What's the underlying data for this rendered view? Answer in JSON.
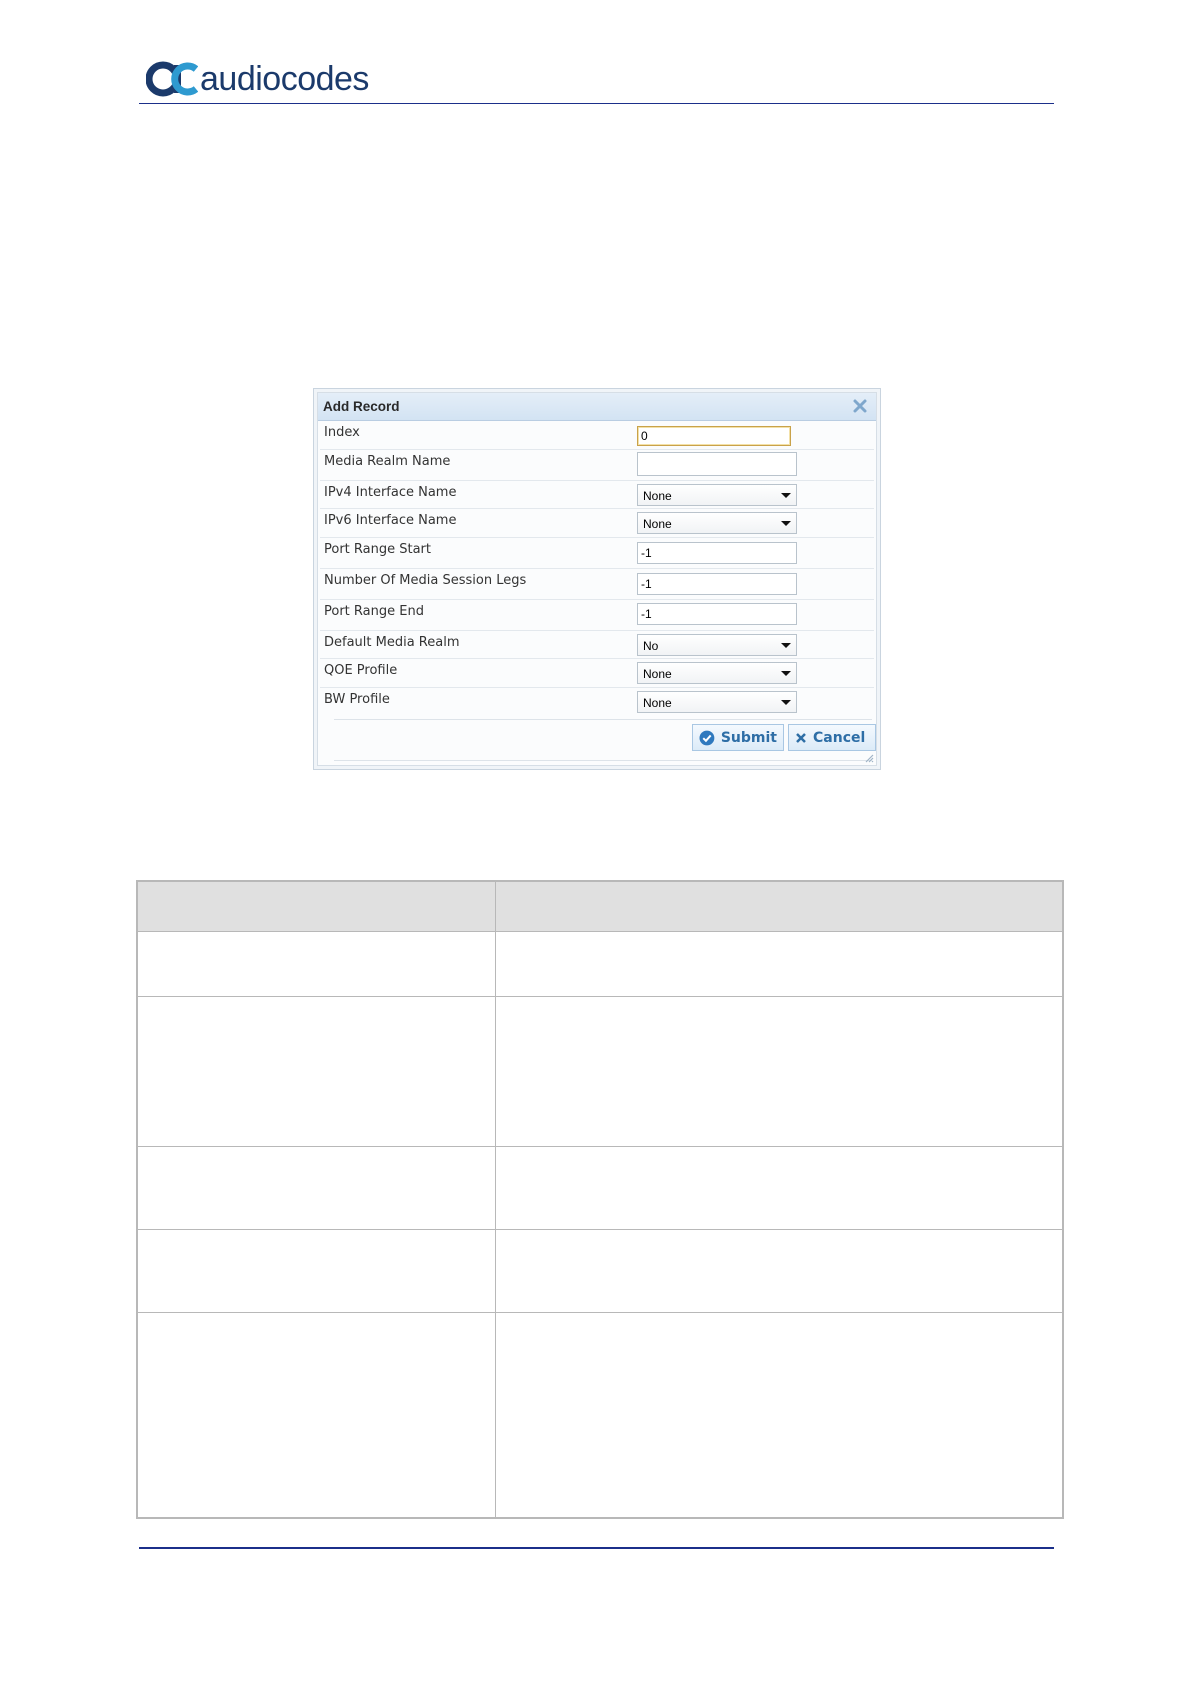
{
  "logo": {
    "text": "audiocodes"
  },
  "dialog": {
    "title": "Add Record",
    "fields": [
      {
        "label": "Index",
        "type": "text",
        "value": "0"
      },
      {
        "label": "Media Realm Name",
        "type": "text",
        "value": ""
      },
      {
        "label": "IPv4 Interface Name",
        "type": "select",
        "value": "None"
      },
      {
        "label": "IPv6 Interface Name",
        "type": "select",
        "value": "None"
      },
      {
        "label": "Port Range Start",
        "type": "text",
        "value": "-1"
      },
      {
        "label": "Number Of Media Session Legs",
        "type": "text",
        "value": "-1"
      },
      {
        "label": "Port Range End",
        "type": "text",
        "value": "-1"
      },
      {
        "label": "Default Media Realm",
        "type": "select",
        "value": "No"
      },
      {
        "label": "QOE Profile",
        "type": "select",
        "value": "None"
      },
      {
        "label": "BW Profile",
        "type": "select",
        "value": "None"
      }
    ],
    "submit_label": "Submit",
    "cancel_label": "Cancel"
  },
  "colors": {
    "brand": "#1b3a6b",
    "accent": "#2e6ea6",
    "rule": "#1b2f8a"
  }
}
